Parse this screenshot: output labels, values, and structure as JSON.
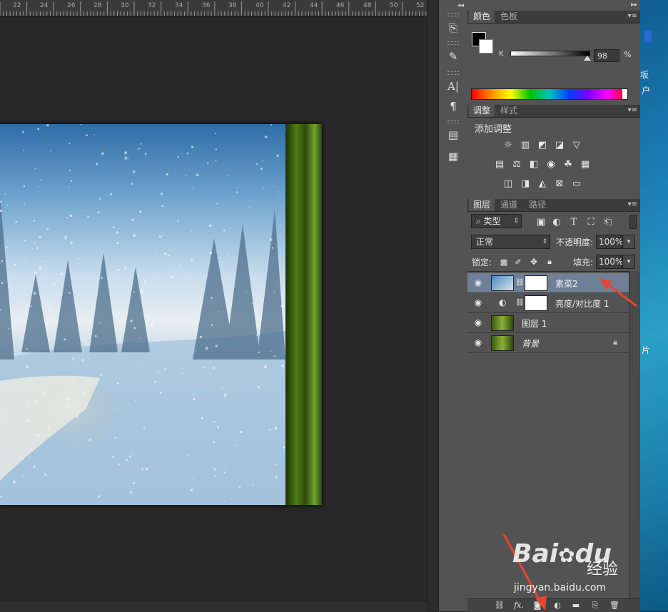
{
  "ruler": {
    "labels": [
      "22",
      "24",
      "26",
      "28",
      "30",
      "32",
      "34",
      "36",
      "38",
      "40",
      "42",
      "44",
      "46",
      "48",
      "50",
      "52"
    ]
  },
  "color_panel": {
    "tabs": [
      "颜色",
      "色板"
    ],
    "channel_label": "K",
    "channel_value": "98",
    "channel_unit": "%",
    "k_level": 0.98
  },
  "adjust_panel": {
    "tabs": [
      "调整",
      "样式"
    ],
    "heading": "添加调整",
    "icons_row1": [
      "brightness-icon",
      "levels-icon",
      "curves-icon",
      "exposure-icon",
      "vibrance-icon"
    ],
    "icons_row2": [
      "hue-saturation-icon",
      "color-balance-icon",
      "black-white-icon",
      "photo-filter-icon",
      "channel-mixer-icon",
      "color-lookup-icon"
    ],
    "icons_row3": [
      "invert-icon",
      "posterize-icon",
      "threshold-icon",
      "selective-color-icon",
      "gradient-map-icon"
    ]
  },
  "layers_panel": {
    "tabs": [
      "图层",
      "通道",
      "路径"
    ],
    "filter_label": "类型",
    "blend_mode": "正常",
    "opacity_label": "不透明度:",
    "opacity_value": "100%",
    "lock_label": "锁定:",
    "fill_label": "填充:",
    "fill_value": "100%",
    "layers": [
      {
        "name": "素菜2",
        "selected": true
      },
      {
        "name": "亮度/对比度 1",
        "selected": false
      },
      {
        "name": "图层 1",
        "selected": false
      },
      {
        "name": "背景",
        "selected": false
      }
    ],
    "footer_icons": [
      "link-icon",
      "fx-icon",
      "mask-icon",
      "adjustment-icon",
      "group-icon",
      "new-layer-icon",
      "trash-icon"
    ],
    "fx_label": "fx."
  },
  "desktop": {
    "chars": [
      "坂",
      "户",
      "片"
    ]
  },
  "watermark": {
    "logo": "Bai",
    "logo2": "du",
    "jingyan": "经验",
    "url": "jingyan.baidu.com"
  },
  "colors": {
    "accent_arrow": "#e8452f",
    "selected_layer": "#6f7f97"
  }
}
